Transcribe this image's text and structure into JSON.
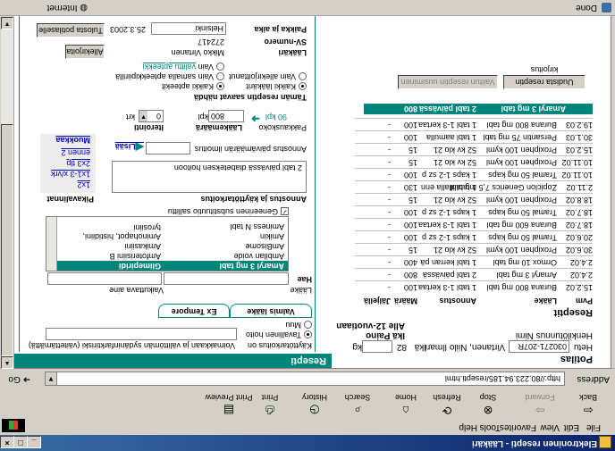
{
  "window": {
    "title": "Elektroninen resepti - Lääkäri",
    "min": "_",
    "max": "□",
    "close": "×"
  },
  "menu": [
    "File",
    "Edit",
    "View",
    "Favorites",
    "Tools",
    "Help"
  ],
  "toolbar": {
    "back": "Back",
    "forward": "Forward",
    "stop": "Stop",
    "refresh": "Refresh",
    "home": "Home",
    "search": "Search",
    "history": "History",
    "print": "Print",
    "print_preview": "Print Preview"
  },
  "address": {
    "label": "Address",
    "url": "http://80.223.94.185/resepti.html",
    "go": "Go"
  },
  "status": {
    "done": "Done",
    "zone": "Internet"
  },
  "left": {
    "section_title": "Potilas",
    "hetu_label": "Hetu",
    "hetu_value": "030271-207R",
    "name_label": "Henkilötunnus Nimi",
    "name_value": "Virtanen, Niilo Ilmari",
    "age_label": "Ikä",
    "age_value": "82",
    "weight_label": "Ikä Paino",
    "weight_unit": "kg",
    "alle12_label": "Alle 12-vuotiaan",
    "resepti_label": "Reseptit",
    "headers": {
      "date": "Pvm",
      "drug": "Lääke",
      "dose": "Annostus",
      "qty": "Määrä",
      "valid": "Jäljellä"
    },
    "rows": [
      {
        "date": "15.2.02",
        "drug": "Burana 800 mg tabl",
        "dose": "1 tabl 1-3 kertaa",
        "qty": "100",
        "valid": "-"
      },
      {
        "date": "2.4.02",
        "drug": "Amaryl 3 mg tabl",
        "dose": "2 tabl päivässä",
        "qty": "800",
        "valid": "-"
      },
      {
        "date": "2.4.02",
        "drug": "Ormox 10 mg tabl",
        "dose": "1 tabl kerran pä",
        "qty": "400",
        "valid": "-"
      },
      {
        "date": "30.6.02",
        "drug": "Proxiphen 100 kyml",
        "dose": "52 kv klo 21",
        "qty": "15",
        "valid": "-"
      },
      {
        "date": "20.6.02",
        "drug": "Tramal 50 mg kaps",
        "dose": "1 kaps 1-2 sz p",
        "qty": "100",
        "valid": "-"
      },
      {
        "date": "18.7.02",
        "drug": "Burana 600 mg tabl",
        "dose": "1 tabl 1-3 kertaa",
        "qty": "100",
        "valid": "-"
      },
      {
        "date": "18.7.02",
        "drug": "Tramal 50 mg kaps",
        "dose": "1 kaps 1-2 sz p",
        "qty": "100",
        "valid": "-"
      },
      {
        "date": "18.8.02",
        "drug": "Proxiphen 100 kyml",
        "dose": "52 kv klo 21",
        "qty": "15",
        "valid": "-"
      },
      {
        "date": "2.11.02",
        "drug": "Zopiclon Generics 7,5 mg tabl",
        "dose": "1 tabl illalla enn",
        "qty": "130",
        "valid": "-"
      },
      {
        "date": "10.11.02",
        "drug": "Tramal 50 mg kaps",
        "dose": "1 kaps 1-2 sz p",
        "qty": "100",
        "valid": "-"
      },
      {
        "date": "10.11.02",
        "drug": "Proxiphen 100 kyml",
        "dose": "52 kv klo 21",
        "qty": "15",
        "valid": "-"
      },
      {
        "date": "15.2.03",
        "drug": "Proxiphen 100 kyml",
        "dose": "52 kv klo 21",
        "qty": "15",
        "valid": "-"
      },
      {
        "date": "30.1.03",
        "drug": "Persantin 75 mg tabl",
        "dose": "1 tabl aamulla",
        "qty": "100",
        "valid": "-"
      },
      {
        "date": "19.2.03",
        "drug": "Burana 800 mg tabl",
        "dose": "1 tabl 1-3 kertaa",
        "qty": "100",
        "valid": "-"
      }
    ],
    "highlight": {
      "drug": "Amaryl 3 mg tabl",
      "dose": "2 tabl päivässä",
      "qty": "800"
    },
    "btn_renew": "Uudista reseptin kirjoitus",
    "btn_renew_selected": "Valitun reseptin uusiminen"
  },
  "right": {
    "section_title": "Resepti",
    "kayttotarkoitus_label": "Käyttötarkoitus on",
    "kayttotarkoitus_value": "Voimakkaan ja välittömän sydäninfarktiriski (väitettämättä)",
    "radio_normal": "Tavallinen hoito",
    "radio_other": "Muu",
    "tab_valmis": "Valmis lääke",
    "tab_extempore": "Ex Tempore",
    "laake_label": "Lääke",
    "vaikuttava_label": "Vaikuttava aine",
    "hae_label": "Hae",
    "list": [
      {
        "drug": "Amaryl 3 mg tabl",
        "agent": "Glimepiridi"
      },
      {
        "drug": "Ambilan voide",
        "agent": "Amfoterisiini B"
      },
      {
        "drug": "AmBisome",
        "agent": "Amikasiini"
      },
      {
        "drug": "Amikin",
        "agent": "Aminohapot, histidiini, tyrosiini"
      },
      {
        "drug": "Aminess N tabl",
        "agent": ""
      }
    ],
    "generic_check": "Geneerinen substituutio sallittu",
    "annostus_label": "Annostus ja käyttötarkoitus",
    "annostus_value": "2 tabl päivässä diabeteksen hoitoon",
    "pikavalinnat_label": "Pikavalinnat",
    "quick": [
      "1x2",
      "1x1-3 x/vrk",
      "2x3 tlp",
      "ennen 2"
    ],
    "muokkaa": "Muokkaa",
    "annostus_pv_label": "Annostus päivämäärän ilmoitus",
    "lisaa": "Lisää",
    "pakkauskoko_label": "Pakkauskoko",
    "pakkauskoko_value": "90 kpl",
    "laakemaara_label": "Lääkemäärä",
    "laakemaara_value": "800",
    "laakemaara_unit": "kpl",
    "iterointi_label": "Iterointi",
    "iterointi_value": "0",
    "iterointi_unit": "krt",
    "saavat_label": "Tämän reseptin saavat nähdä",
    "r_kaikki_laakarit": "Kaikki lääkärit",
    "r_kaikki_apteekit": "Kaikki apteekit",
    "r_vain_laakari": "Vain allekirjoittanut",
    "r_vain_apteekki": "Vain samalla apteekkipiirillä",
    "r_vain_valittu": "Vain",
    "valittu_apteekki": "valittu apteekki",
    "laakari_label": "Lääkäri",
    "laakari_value": "Mikko Virtanen",
    "sv_label": "SV-numero",
    "sv_value": "272417",
    "paikka_label": "Paikka ja aika",
    "paikka_value": "Helsinki",
    "date_value": "25.3.2003",
    "btn_print": "Tulosta potilaselle",
    "btn_sign": "Allekirjoita"
  }
}
